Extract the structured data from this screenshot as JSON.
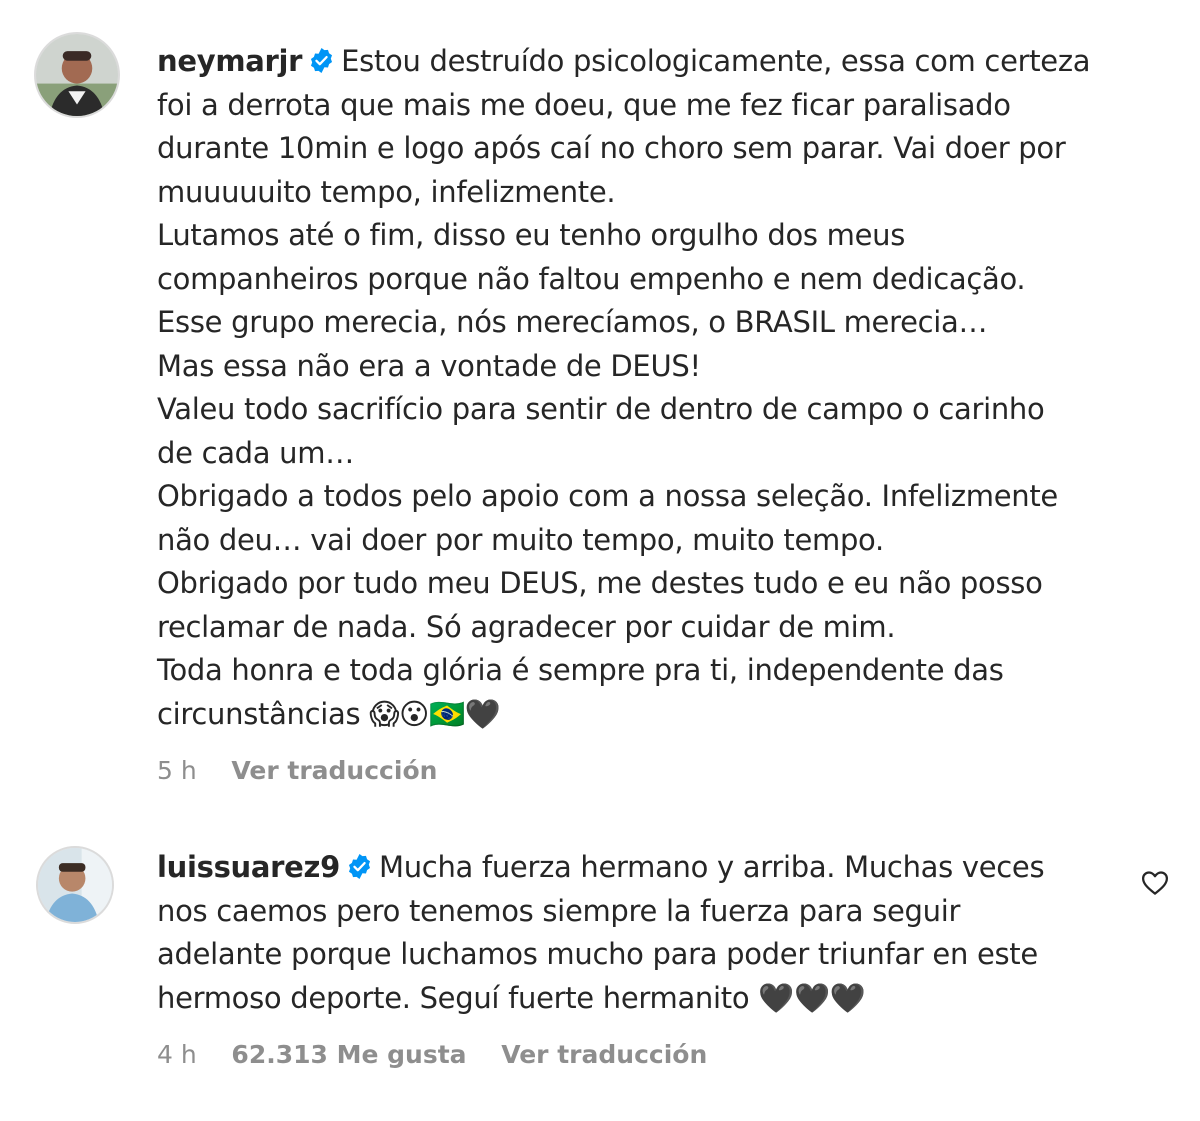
{
  "comments": [
    {
      "username": "neymarjr",
      "verified": true,
      "text_lines": [
        "Estou destruído psicologicamente, essa com certeza",
        "foi a derrota que mais me doeu, que me fez ficar paralisado",
        "durante 10min e logo após caí no choro sem parar. Vai doer por",
        "muuuuuito tempo, infelizmente.",
        "Lutamos até o fim, disso eu tenho orgulho dos meus",
        "companheiros porque não faltou empenho e nem dedicação.",
        "Esse grupo merecia, nós merecíamos, o BRASIL merecia…",
        "Mas essa não era a vontade de DEUS!",
        "Valeu todo sacrifício para sentir de dentro de campo o carinho",
        "de cada um…",
        "Obrigado a todos pelo apoio com a nossa seleção. Infelizmente",
        "não deu… vai doer por muito tempo, muito tempo.",
        "Obrigado por tudo meu DEUS, me destes tudo e eu não posso",
        "reclamar de nada. Só agradecer por cuidar de mim.",
        "Toda honra e toda glória é sempre pra ti, independente das",
        "circunstâncias 😱😮🇧🇷🖤"
      ],
      "time": "5 h",
      "translate_label": "Ver traducción",
      "avatar_icon": "user-avatar-icon"
    },
    {
      "username": "luissuarez9",
      "verified": true,
      "text_lines": [
        "Mucha fuerza hermano y arriba. Muchas veces",
        "nos caemos pero tenemos siempre la fuerza para seguir",
        "adelante porque luchamos mucho para poder triunfar en este",
        "hermoso deporte. Seguí fuerte hermanito 🖤🖤🖤"
      ],
      "time": "4 h",
      "likes_label": "62.313 Me gusta",
      "translate_label": "Ver traducción",
      "like_icon": "heart-icon",
      "avatar_icon": "user-avatar-icon"
    }
  ],
  "colors": {
    "text": "#262626",
    "secondary": "#8e8e8e",
    "verified_badge": "#0095f6",
    "avatar_border": "#dbdbdb"
  }
}
